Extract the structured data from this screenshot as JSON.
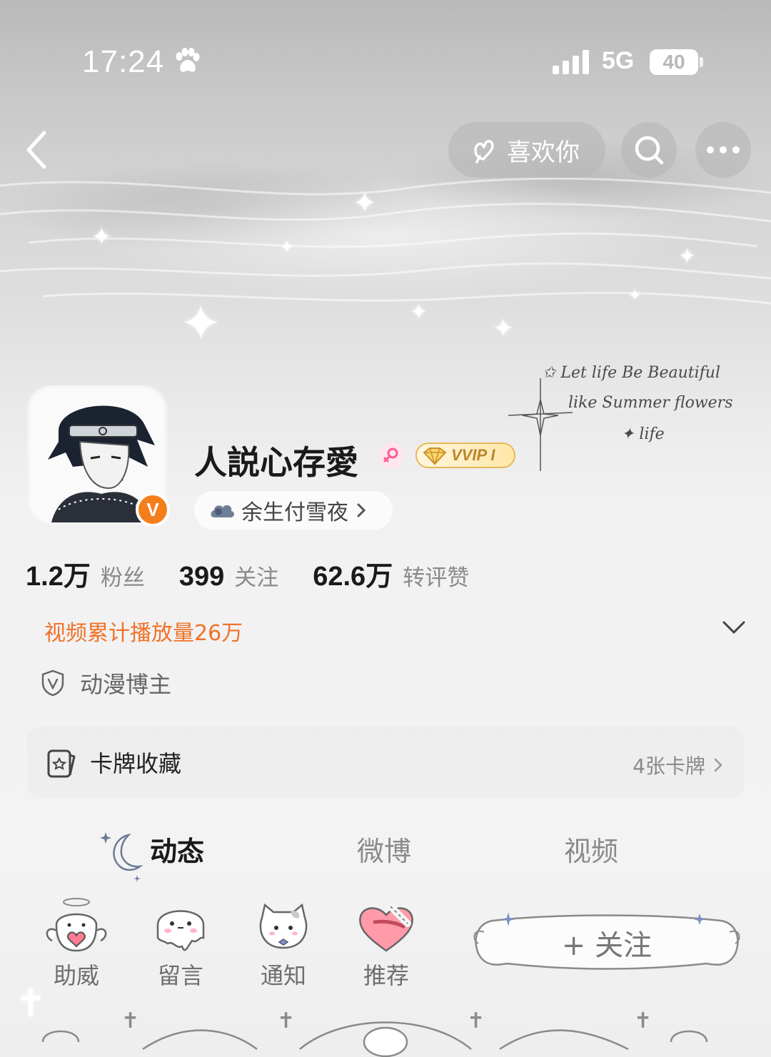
{
  "status_bar": {
    "time": "17:24",
    "network": "5G",
    "battery": "40"
  },
  "nav": {
    "like_label": "喜欢你",
    "icons": [
      "back-icon",
      "heart-hand-icon",
      "search-icon",
      "more-icon"
    ]
  },
  "decoration": {
    "handwritten_lines": [
      "✩ Let life Be Beautiful",
      "like Summer flowers",
      "✦ life"
    ]
  },
  "profile": {
    "username": "人説心存愛",
    "verified_mark": "V",
    "vip_label": "VVIP I",
    "fan_group": "余生付雪夜"
  },
  "stats": [
    {
      "value": "1.2万",
      "label": "粉丝"
    },
    {
      "value": "399",
      "label": "关注"
    },
    {
      "value": "62.6万",
      "label": "转评赞"
    }
  ],
  "video_plays": "视频累计播放量26万",
  "tag": "动漫博主",
  "cards": {
    "title": "卡牌收藏",
    "count": "4张卡牌"
  },
  "tabs": [
    {
      "label": "动态",
      "active": true
    },
    {
      "label": "微博",
      "active": false
    },
    {
      "label": "视频",
      "active": false
    }
  ],
  "features": [
    {
      "label": "助威",
      "icon": "angel-heart-icon"
    },
    {
      "label": "留言",
      "icon": "ghost-icon"
    },
    {
      "label": "通知",
      "icon": "cat-icon"
    },
    {
      "label": "推荐",
      "icon": "heart-bandage-icon"
    }
  ],
  "follow_label": "+ 关注",
  "colors": {
    "accent_orange": "#f07228",
    "verified_orange": "#f57e1c",
    "vip_gold": "#e6b85a",
    "gender_pink": "#ff5d8f"
  }
}
